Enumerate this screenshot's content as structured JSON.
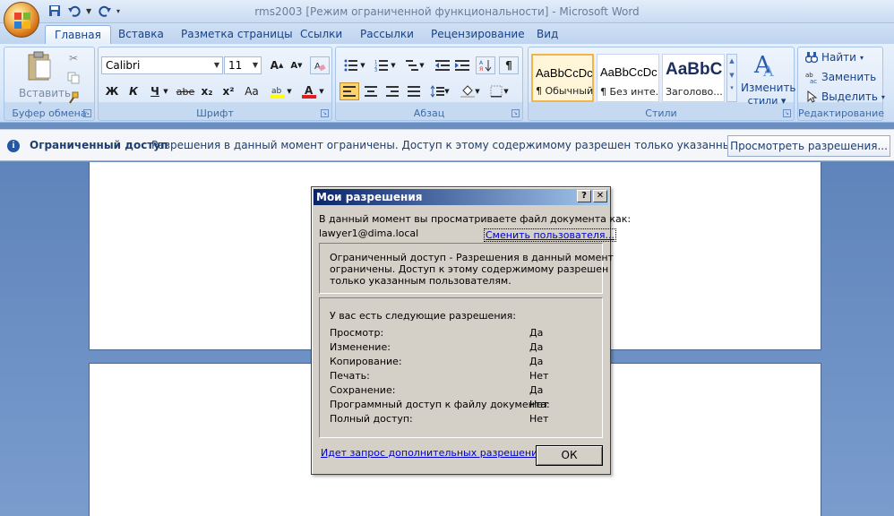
{
  "window": {
    "title_doc": "rms2003 [Режим ограниченной функциональности]",
    "title_sep": " - ",
    "title_app": "Microsoft Word"
  },
  "tabs": [
    "Главная",
    "Вставка",
    "Разметка страницы",
    "Ссылки",
    "Рассылки",
    "Рецензирование",
    "Вид"
  ],
  "ribbon": {
    "clipboard": {
      "label": "Буфер обмена",
      "paste": "Вставить"
    },
    "font": {
      "label": "Шрифт",
      "name": "Calibri",
      "size": "11",
      "bold": "Ж",
      "italic": "К",
      "underline": "Ч",
      "strike": "abe",
      "sub": "x₂",
      "sup": "x²",
      "case": "Aa"
    },
    "paragraph": {
      "label": "Абзац"
    },
    "styles": {
      "label": "Стили",
      "items": [
        {
          "sample": "AaBbCcDc",
          "name": "¶ Обычный"
        },
        {
          "sample": "AaBbCcDc",
          "name": "¶ Без инте..."
        },
        {
          "sample": "AaBbC",
          "name": "Заголово..."
        }
      ],
      "change": "Изменить",
      "change2": "стили"
    },
    "editing": {
      "label": "Редактирование",
      "find": "Найти",
      "replace": "Заменить",
      "select": "Выделить"
    }
  },
  "message_bar": {
    "title": "Ограниченный доступ",
    "text": "Разрешения в данный момент ограничены. Доступ к этому содержимому разрешен только указанным пользовател...",
    "button": "Просмотреть разрешения..."
  },
  "dialog": {
    "title": "Мои разрешения",
    "help": "?",
    "close": "✕",
    "viewing_as": "В данный момент вы просматриваете файл документа как:",
    "user": "lawyer1@dima.local",
    "change_user": "Сменить пользователя...",
    "restricted_lines": [
      "Ограниченный доступ - Разрешения в данный момент",
      "ограничены. Доступ к этому содержимому разрешен",
      "только указанным пользователям."
    ],
    "perm_header": "У вас есть следующие разрешения:",
    "permissions": [
      {
        "name": "Просмотр:",
        "value": "Да"
      },
      {
        "name": "Изменение:",
        "value": "Да"
      },
      {
        "name": "Копирование:",
        "value": "Да"
      },
      {
        "name": "Печать:",
        "value": "Нет"
      },
      {
        "name": "Сохранение:",
        "value": "Да"
      },
      {
        "name": "Программный доступ к файлу документа:",
        "value": "Нет"
      },
      {
        "name": "Полный доступ:",
        "value": "Нет"
      }
    ],
    "request_link": "Идет запрос дополнительных разрешений...",
    "ok": "ОК"
  }
}
